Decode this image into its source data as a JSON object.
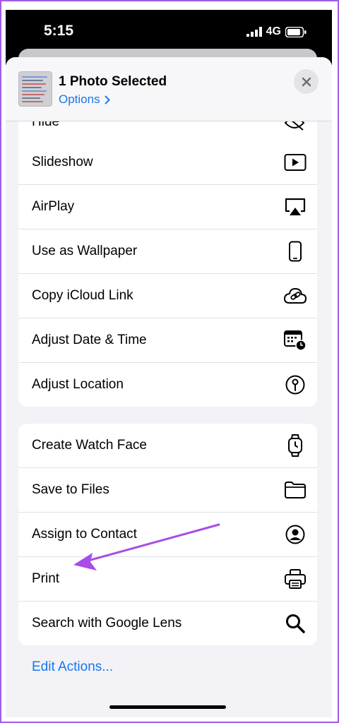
{
  "status_bar": {
    "time": "5:15",
    "network": "4G"
  },
  "header": {
    "title": "1 Photo Selected",
    "options_label": "Options",
    "options_chevron": ">"
  },
  "peek_item": {
    "label": "Hide",
    "icon": "eye-slash-icon"
  },
  "group1": [
    {
      "label": "Slideshow",
      "icon": "play-icon"
    },
    {
      "label": "AirPlay",
      "icon": "airplay-icon"
    },
    {
      "label": "Use as Wallpaper",
      "icon": "phone-icon"
    },
    {
      "label": "Copy iCloud Link",
      "icon": "cloud-link-icon"
    },
    {
      "label": "Adjust Date & Time",
      "icon": "calendar-clock-icon"
    },
    {
      "label": "Adjust Location",
      "icon": "location-pin-icon"
    }
  ],
  "group2": [
    {
      "label": "Create Watch Face",
      "icon": "watch-icon"
    },
    {
      "label": "Save to Files",
      "icon": "folder-icon"
    },
    {
      "label": "Assign to Contact",
      "icon": "person-circle-icon"
    },
    {
      "label": "Print",
      "icon": "printer-icon"
    },
    {
      "label": "Search with Google Lens",
      "icon": "magnifier-icon"
    }
  ],
  "footer": {
    "edit_actions_label": "Edit Actions..."
  },
  "annotation": {
    "arrow_color": "#a84de8",
    "points_to": "Print"
  },
  "colors": {
    "accent": "#1677f0",
    "frame": "#a25ce6",
    "background": "#f2f2f7"
  }
}
